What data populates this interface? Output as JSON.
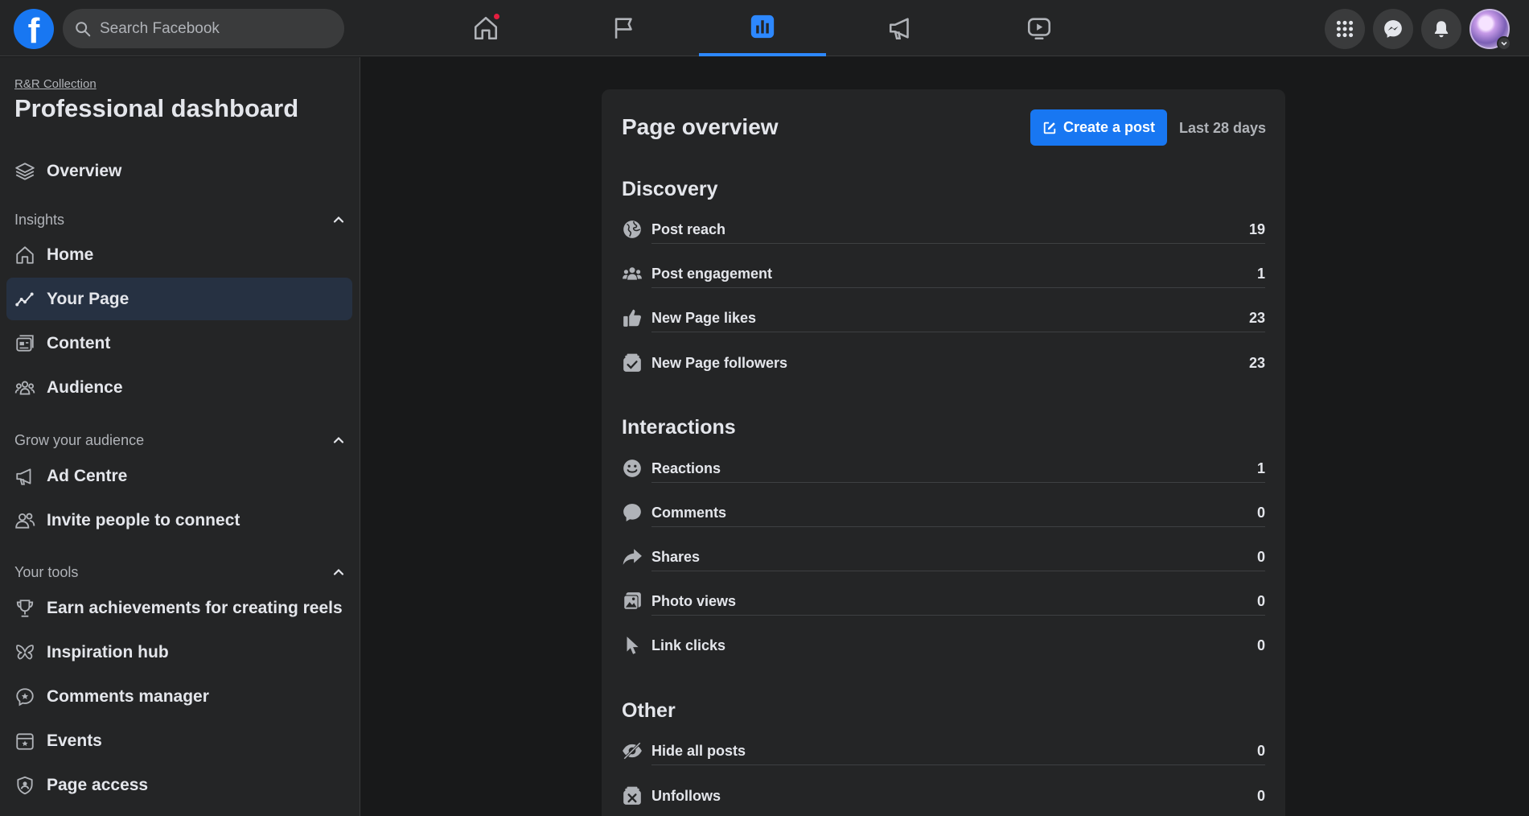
{
  "topbar": {
    "logo": "f",
    "search_placeholder": "Search Facebook",
    "nav": [
      {
        "icon": "home-icon",
        "badge": true
      },
      {
        "icon": "flag-icon"
      },
      {
        "icon": "insights-icon",
        "active": true
      },
      {
        "icon": "megaphone-icon"
      },
      {
        "icon": "video-icon"
      }
    ],
    "actions": [
      "menu-grid-icon",
      "messenger-icon",
      "bell-icon"
    ]
  },
  "sidebar": {
    "page_name": "R&R Collection",
    "title": "Professional dashboard",
    "overview": "Overview",
    "insights_label": "Insights",
    "insights_items": [
      "Home",
      "Your Page",
      "Content",
      "Audience"
    ],
    "grow_label": "Grow your audience",
    "grow_items": [
      "Ad Centre",
      "Invite people to connect"
    ],
    "tools_label": "Your tools",
    "tools_items": [
      "Earn achievements for creating reels",
      "Inspiration hub",
      "Comments manager",
      "Events",
      "Page access"
    ]
  },
  "overview": {
    "title": "Page overview",
    "create_post": "Create a post",
    "range": "Last 28 days",
    "discovery": {
      "title": "Discovery",
      "metrics": [
        {
          "label": "Post reach",
          "value": "19"
        },
        {
          "label": "Post engagement",
          "value": "1"
        },
        {
          "label": "New Page likes",
          "value": "23"
        },
        {
          "label": "New Page followers",
          "value": "23"
        }
      ]
    },
    "interactions": {
      "title": "Interactions",
      "metrics": [
        {
          "label": "Reactions",
          "value": "1"
        },
        {
          "label": "Comments",
          "value": "0"
        },
        {
          "label": "Shares",
          "value": "0"
        },
        {
          "label": "Photo views",
          "value": "0"
        },
        {
          "label": "Link clicks",
          "value": "0"
        }
      ]
    },
    "other": {
      "title": "Other",
      "metrics": [
        {
          "label": "Hide all posts",
          "value": "0"
        },
        {
          "label": "Unfollows",
          "value": "0"
        }
      ]
    }
  },
  "colors": {
    "accent": "#1877f2",
    "active_tab": "#2d88ff",
    "badge": "#e41e3f"
  }
}
